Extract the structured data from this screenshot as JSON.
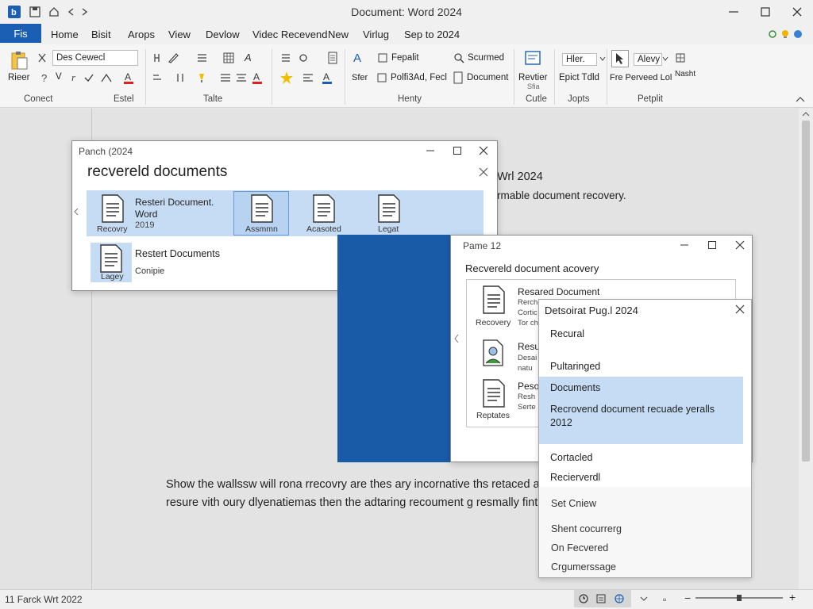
{
  "window": {
    "title": "Document: Word 2024",
    "controls": [
      "minimize-icon",
      "maximize-icon",
      "close-icon"
    ]
  },
  "menu": {
    "file": "Fis",
    "tabs": [
      "Home",
      "Bisit",
      "Arops",
      "View",
      "Devlow",
      "Videc Recevend",
      "New",
      "Virlug",
      "Sep to 2024"
    ]
  },
  "ribbon": {
    "font_box": "Des Cewecl",
    "paste_label": "Rieer",
    "paste_arrow": "▾",
    "b_glyph": "V",
    "find_label": "Fepalit",
    "find_label2": "Polfi3Ad, Fecl",
    "scurmed": "Scurmed",
    "document_btn": "Document",
    "revtier": "Revtier",
    "revtier_sub": "Sfia",
    "hler": "Hler.",
    "epict": "Epict Tdld",
    "alevy": "Alevy",
    "fre_perveed": "Fre Perveed Lol",
    "nasht": "Nasht",
    "groups": [
      "Conect",
      "Estel",
      "Talte",
      "Henty",
      "Cutle",
      "Jopts",
      "Petplit"
    ]
  },
  "body": {
    "heading_right": "Wrl 2024",
    "line_right": "rmable document recovery.",
    "para1": "Show the wallssw will rona rrecovry are thes ary incornative ths retaced a",
    "para2": "resure vith oury dlyenatiemas then the adtaring recoument g resmally fint"
  },
  "dialog1": {
    "title": "Panch (2024",
    "heading": "recvereld documents",
    "tiles": [
      {
        "label": "Recovry"
      },
      {
        "label": "Assmmn"
      },
      {
        "label": "Acasoted"
      },
      {
        "label": "Legat"
      }
    ],
    "first_text": {
      "line1": "Resteri Document.",
      "line2": "Word",
      "line3": "2019"
    },
    "row2": {
      "icon_label": "Lagey",
      "title": "Restert Documents",
      "sub": "Conipie"
    }
  },
  "dialog2": {
    "title": "Pame 12",
    "heading": "Recvereld document acovery",
    "items": [
      {
        "label": "Recovery",
        "title": "Resared Document",
        "sub": [
          "Rerch",
          "Cortic",
          "Tor ch"
        ]
      },
      {
        "label": "",
        "title": "Resu",
        "sub": [
          "Desai",
          "natu"
        ]
      },
      {
        "label": "Reptates",
        "title": "Peso",
        "sub": [
          "Resh",
          "Serte"
        ]
      }
    ]
  },
  "popup": {
    "title": "Detsoirat Pug.l 2024",
    "items": [
      "Recural",
      "Pultaringed"
    ],
    "selected": [
      "Documents",
      "Recrovend document recuade yeralls",
      "2012"
    ],
    "after": [
      "Cortacled",
      "Recierverdl"
    ],
    "extra": [
      "Set Cniew",
      "Shent cocurrerg",
      "On Fecvered",
      "Crgumerssage"
    ]
  },
  "status": {
    "left": "11 Farck Wrt 2022",
    "zoom_minus": "−",
    "zoom_plus": "+"
  },
  "colors": {
    "accent": "#1a5fb4",
    "selection": "#c6dcf5",
    "panel_blue": "#1a5ba8"
  }
}
